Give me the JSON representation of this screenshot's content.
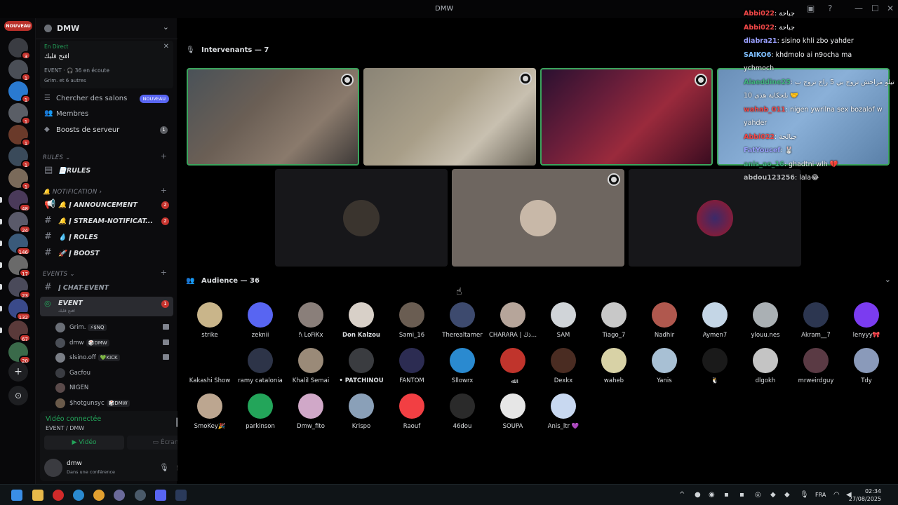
{
  "window": {
    "title": "DMW"
  },
  "rail": {
    "new_badge": "NOUVEAU",
    "servers": [
      {
        "badge": "3"
      },
      {
        "badge": "1"
      },
      {
        "badge": "1"
      },
      {
        "badge": "1"
      },
      {
        "badge": "1"
      },
      {
        "badge": "1"
      },
      {
        "badge": "1"
      },
      {
        "badge": "48"
      },
      {
        "badge": "24"
      },
      {
        "badge": "146"
      },
      {
        "badge": "17"
      },
      {
        "badge": "23"
      },
      {
        "badge": "132"
      },
      {
        "badge": "67"
      },
      {
        "badge": "20"
      }
    ],
    "add_server_icon": "plus-icon",
    "discover_icon": "compass-icon"
  },
  "server": {
    "name": "DMW"
  },
  "live_card": {
    "status": "En Direct",
    "title": "افتح قلبك",
    "event": "EVENT · 🎧 36 en écoute",
    "people": "Grim. et 6 autres"
  },
  "nav": {
    "browse": "Chercher des salons",
    "browse_badge": "NOUVEAU",
    "members": "Membres",
    "boosts": "Boosts de serveur",
    "boosts_count": "1"
  },
  "categories": {
    "rules": "RULES",
    "notification": "NOTIFICATION",
    "events": "EVENTS"
  },
  "channels": {
    "rules": "📄RULES",
    "announcement": "🔔 ǀ ANNOUNCEMENT",
    "announcement_badge": "2",
    "stream": "🔔 ǀ STREAM-NOTIFICAT...",
    "stream_badge": "2",
    "roles": "💧 ǀ ROLES",
    "boost": "🚀 ǀ BOOST",
    "chat_event": "ǀ CHAT-EVENT",
    "event": "EVENT",
    "event_sub": "افتح قلبك",
    "event_badge": "1"
  },
  "voice_members": [
    {
      "name": "Grim.",
      "tag": "⚡$NQ",
      "cam": true
    },
    {
      "name": "dmw",
      "tag": "🎲DMW",
      "cam": true
    },
    {
      "name": "slsino.off",
      "tag": "💚KICK",
      "cam": true
    },
    {
      "name": "Gacfou",
      "tag": "",
      "cam": false
    },
    {
      "name": "NIGEN",
      "tag": "",
      "cam": false
    },
    {
      "name": "$hotgunsyc",
      "tag": "🎲DMW",
      "cam": false
    }
  ],
  "voice_panel": {
    "status": "Vidéo connectée",
    "where": "EVENT / DMW",
    "video_label": "Vidéo",
    "screen_label": "Écran",
    "user_name": "dmw",
    "user_status": "Dans une conférence"
  },
  "stage": {
    "speakers_header": "Intervenants — 7",
    "audience_header": "Audience — 36"
  },
  "audience": [
    {
      "name": "strike",
      "color": "#c9b58a"
    },
    {
      "name": "zeknii",
      "color": "#5865f2"
    },
    {
      "name": "ǃ\\ LoFiKx",
      "color": "#8a7f7a"
    },
    {
      "name": "Don Kalzou",
      "color": "#d8d0c8",
      "bold": true
    },
    {
      "name": "Šəmi_16",
      "color": "#6a5d52"
    },
    {
      "name": "Therealtamer",
      "color": "#3d4a6e"
    },
    {
      "name": "CHARARA | ذڭ...",
      "color": "#b6a59a"
    },
    {
      "name": "SAM",
      "color": "#d0d4d8"
    },
    {
      "name": "Tiago_7",
      "color": "#c8c8c8"
    },
    {
      "name": "Nadhir",
      "color": "#b0584e"
    },
    {
      "name": "Aymen7",
      "color": "#c4d6e6"
    },
    {
      "name": "ylouu.nes",
      "color": "#aab0b4"
    },
    {
      "name": "Akram__7",
      "color": "#2c3650"
    },
    {
      "name": "lenyyy🎀",
      "color": "#7b3cf0"
    },
    {
      "name": "Kakashi Show",
      "color": "#000000"
    },
    {
      "name": "ramy catalonia",
      "color": "#2d3448"
    },
    {
      "name": "Khalil Semai",
      "color": "#9a8a78"
    },
    {
      "name": "• PATCHINOU",
      "color": "#3a3c40",
      "bold": true
    },
    {
      "name": "FANTOM",
      "color": "#2c2c52"
    },
    {
      "name": "Sllowrx",
      "color": "#2a8ad0"
    },
    {
      "name": "ﷲ",
      "color": "#c0342c"
    },
    {
      "name": "Dexkx",
      "color": "#4a2c22"
    },
    {
      "name": "waheb",
      "color": "#d8d2a6"
    },
    {
      "name": "Yanis",
      "color": "#a8c0d4"
    },
    {
      "name": "🐧",
      "color": "#1a1a1a"
    },
    {
      "name": "dlgokh",
      "color": "#c4c4c4"
    },
    {
      "name": "mrweirdguy",
      "color": "#5a3a44"
    },
    {
      "name": "Tdy",
      "color": "#8a9aba"
    },
    {
      "name": "SmoKey🎉",
      "color": "#bca690"
    },
    {
      "name": "parkinson",
      "color": "#23a55a"
    },
    {
      "name": "Dmw_fito",
      "color": "#d0a8c8"
    },
    {
      "name": "Krispo",
      "color": "#8aa0b8"
    },
    {
      "name": "Raouf",
      "color": "#f23f43"
    },
    {
      "name": "46dou",
      "color": "#2a2a2a"
    },
    {
      "name": "SOUPA",
      "color": "#e6e6e6"
    },
    {
      "name": "Anis_ltr 💜",
      "color": "#c8d8f0"
    }
  ],
  "chat": [
    {
      "user": "Abbi022",
      "text": ": جباحة",
      "color": "#f04747"
    },
    {
      "user": "Abbi022",
      "text": ": جباحة",
      "color": "#f04747"
    },
    {
      "user": "diabra21",
      "text": ": sisino khli zbo yahder",
      "color": "#9aa0ff"
    },
    {
      "user": "SAIKO6",
      "text": ": khdmolo ai n9ocha ma",
      "color": "#7fbfff"
    },
    {
      "user": "",
      "text": "ychmoch",
      "color": "#ffffff"
    },
    {
      "user": "Alaeddine25",
      "text": ": تيلو مراحش تروح بي 5 راح تروح ب",
      "color": "#43b581"
    },
    {
      "user": "",
      "text": "10 بلحكاية هذي 🤝",
      "color": "#ffffff"
    },
    {
      "user": "wahab_011",
      "text": ": nigen ywrilna sex bozalof w",
      "color": "#f04747"
    },
    {
      "user": "",
      "text": "yahder",
      "color": "#ffffff"
    },
    {
      "user": "Abbi022",
      "text": ": جبالحة",
      "color": "#f04747"
    },
    {
      "user": "FatYoucef",
      "text": ": 🐰",
      "color": "#9aa0ff"
    },
    {
      "user": "anis_ao_16",
      "text": ": ghadtni wlh 💔",
      "color": "#43b581"
    },
    {
      "user": "abdou123256",
      "text": ": lala😂",
      "color": "#b9bbbe"
    }
  ],
  "taskbar": {
    "lang": "FRA",
    "time": "02:34",
    "date": "27/08/2025"
  }
}
